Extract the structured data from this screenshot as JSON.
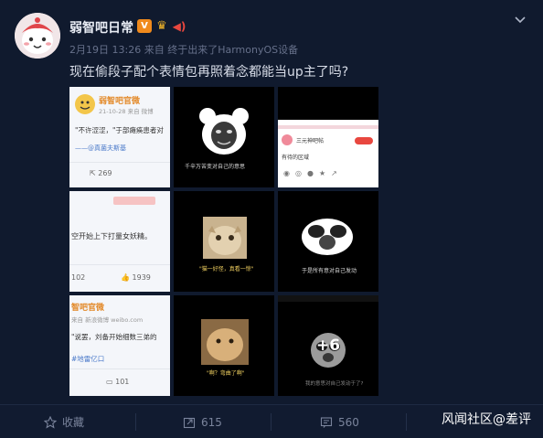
{
  "post": {
    "username": "弱智吧日常",
    "date": "2月19日 13:26",
    "source_prefix": "来自",
    "source": "终于出来了HarmonyOS设备",
    "text": "现在偷段子配个表情包再照着念都能当up主了吗?"
  },
  "images": {
    "tile0": {
      "account": "弱智吧官微",
      "time": "21-10-28",
      "from": "来自 微博",
      "quote": "\"不许涩涩，\"于部瘫痪患者对",
      "author": "——@真菌夫斯基",
      "reposts": "269"
    },
    "tile1": {
      "caption": "千辛万苦变对自己的意思"
    },
    "tile2": {
      "title": "三元神吧帖",
      "label": "有待的区域"
    },
    "tile3": {
      "line": "空开始上下打量女妖精。",
      "comments": "102",
      "likes": "1939"
    },
    "tile4": {
      "caption": "\"猫一好怪，真看一惊\""
    },
    "tile5": {
      "caption": "于是所有意对自己发动"
    },
    "tile6": {
      "account": "智吧官微",
      "from": "来自 新浪微博 weibo.com",
      "quote": "\"说罢，刘备开始细数三弟的",
      "topic": "#地雷亿口",
      "comments": "101"
    },
    "tile7": {
      "caption": "\"啊？弯曲了啊\""
    },
    "tile8": {
      "more": "+6",
      "caption": "我的意思对自己发动于了?"
    }
  },
  "actions": {
    "favorite": "收藏",
    "repost": "615",
    "comment": "560"
  },
  "watermark": "风闻社区@差评",
  "colors": {
    "background": "#101a2e",
    "accent_orange": "#f08a1c",
    "red": "#e8473f"
  }
}
